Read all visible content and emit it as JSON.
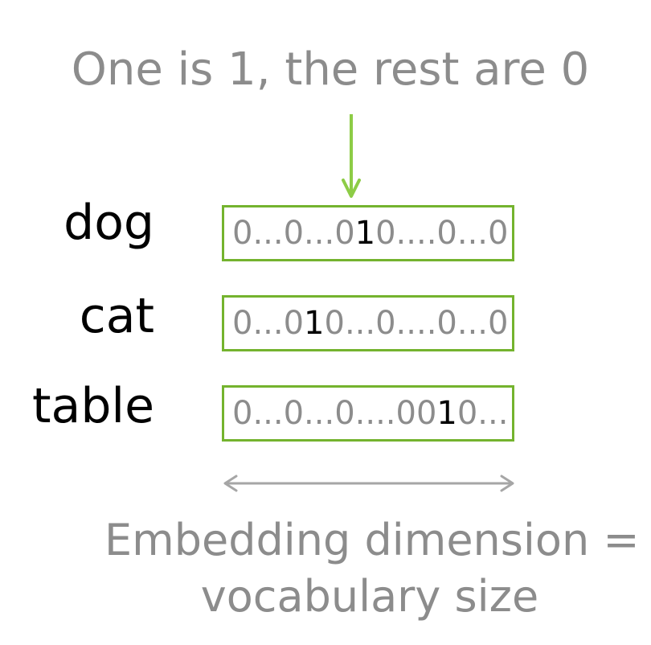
{
  "title": "One is 1, the rest are 0",
  "rows": [
    {
      "word": "dog",
      "prefix": "0...0...0",
      "one": "1",
      "suffix": "0....0...0"
    },
    {
      "word": "cat",
      "prefix": "0...0",
      "one": "1",
      "suffix": "0...0....0...0"
    },
    {
      "word": "table",
      "prefix": "0...0...0....00",
      "one": "1",
      "suffix": "0..."
    }
  ],
  "caption": {
    "line1": "Embedding dimension =",
    "line2": "vocabulary size"
  },
  "colors": {
    "accent_green": "#74b32e",
    "arrow_green": "#8dcc46",
    "text_gray": "#8c8c8c",
    "dimension_arrow_gray": "#a6a6a6"
  }
}
